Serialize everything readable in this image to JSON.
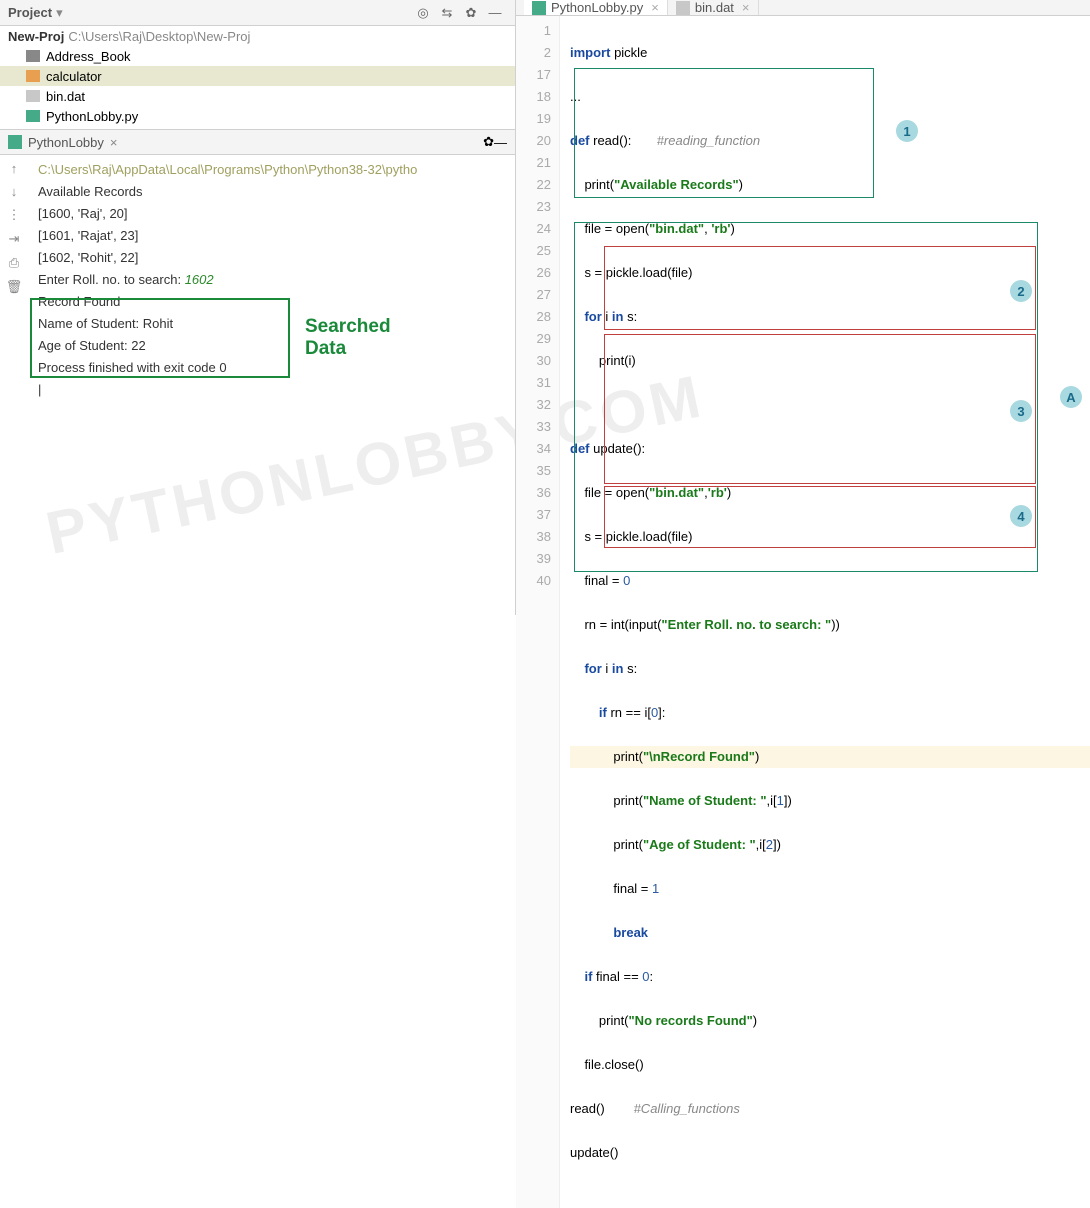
{
  "project": {
    "title": "Project",
    "root_name": "New-Proj",
    "root_path": "C:\\Users\\Raj\\Desktop\\New-Proj",
    "items": [
      {
        "name": "Address_Book",
        "type": "folder"
      },
      {
        "name": "calculator",
        "type": "folder",
        "selected": true
      },
      {
        "name": "bin.dat",
        "type": "file"
      },
      {
        "name": "PythonLobby.py",
        "type": "python"
      }
    ]
  },
  "console": {
    "tab_name": "PythonLobby",
    "output": {
      "path": "C:\\Users\\Raj\\AppData\\Local\\Programs\\Python\\Python38-32\\pytho",
      "l1": "Available Records",
      "l2": "[1600, 'Raj', 20]",
      "l3": "[1601, 'Rajat', 23]",
      "l4": "[1602, 'Rohit', 22]",
      "l5a": "Enter Roll. no. to search: ",
      "l5b": "1602",
      "l6": "",
      "l7": "Record Found",
      "l8": "Name of Student:  Rohit",
      "l9": "Age of Student:  22",
      "l10": "",
      "l11": "Process finished with exit code 0"
    },
    "box_label": "Searched\nData"
  },
  "editor": {
    "tabs": [
      {
        "name": "PythonLobby.py",
        "active": true
      },
      {
        "name": "bin.dat",
        "active": false
      }
    ],
    "line_numbers": [
      "1",
      "2",
      "17",
      "18",
      "19",
      "20",
      "21",
      "22",
      "23",
      "24",
      "25",
      "26",
      "27",
      "28",
      "29",
      "30",
      "31",
      "32",
      "33",
      "34",
      "35",
      "36",
      "37",
      "38",
      "39",
      "40"
    ],
    "code": {
      "l1_kw": "import",
      "l1_rest": " pickle",
      "l2": "...",
      "l17_def": "def",
      "l17_name": " read():",
      "l17_cmt": "       #reading_function",
      "l18_a": "    print(",
      "l18_s": "\"Available Records\"",
      "l18_b": ")",
      "l19_a": "    file = open(",
      "l19_s": "\"bin.dat\"",
      "l19_b": ", ",
      "l19_s2": "'rb'",
      "l19_c": ")",
      "l20": "    s = pickle.load(file)",
      "l21_a": "    ",
      "l21_for": "for",
      "l21_b": " i ",
      "l21_in": "in",
      "l21_c": " s:",
      "l22": "        print(i)",
      "l23": "",
      "l24_def": "def",
      "l24_name": " update():",
      "l25_a": "    file = open(",
      "l25_s": "\"bin.dat\"",
      "l25_b": ",",
      "l25_s2": "'rb'",
      "l25_c": ")",
      "l26": "    s = pickle.load(file)",
      "l27_a": "    final = ",
      "l27_n": "0",
      "l28_a": "    rn = int(input(",
      "l28_s": "\"Enter Roll. no. to search: \"",
      "l28_b": "))",
      "l29_a": "    ",
      "l29_for": "for",
      "l29_b": " i ",
      "l29_in": "in",
      "l29_c": " s:",
      "l30_a": "        ",
      "l30_if": "if",
      "l30_b": " rn == i[",
      "l30_n": "0",
      "l30_c": "]:",
      "l31_a": "            print(",
      "l31_s": "\"\\nRecord Found\"",
      "l31_b": ")",
      "l32_a": "            print(",
      "l32_s": "\"Name of Student: \"",
      "l32_b": ",i[",
      "l32_n": "1",
      "l32_c": "])",
      "l33_a": "            print(",
      "l33_s": "\"Age of Student: \"",
      "l33_b": ",i[",
      "l33_n": "2",
      "l33_c": "])",
      "l34_a": "            final = ",
      "l34_n": "1",
      "l35_a": "            ",
      "l35_kw": "break",
      "l36_a": "    ",
      "l36_if": "if",
      "l36_b": " final == ",
      "l36_n": "0",
      "l36_c": ":",
      "l37_a": "        print(",
      "l37_s": "\"No records Found\"",
      "l37_b": ")",
      "l38": "    file.close()",
      "l39_a": "read()",
      "l39_cmt": "        #Calling_functions",
      "l40": "update()"
    }
  },
  "annotations": {
    "c1": "1",
    "c2": "2",
    "c3": "3",
    "c4": "4",
    "cA": "A"
  },
  "watermark": "PYTHONLOBBY.COM"
}
